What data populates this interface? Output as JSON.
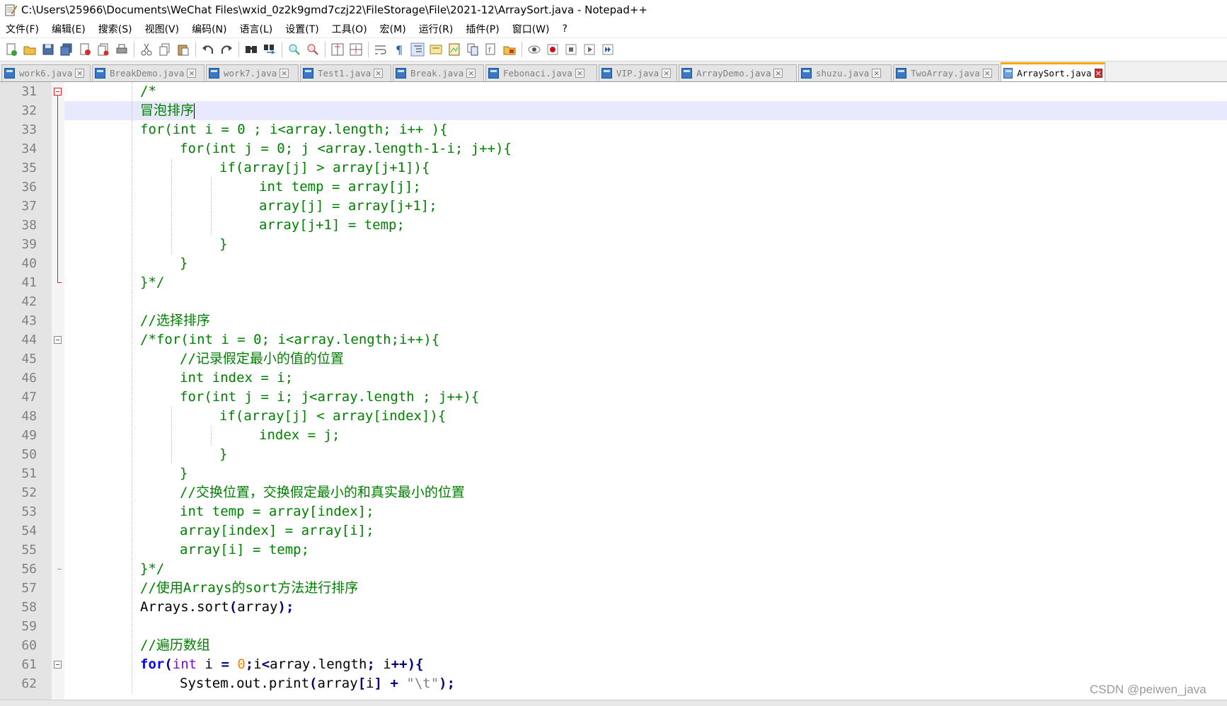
{
  "window": {
    "title": "C:\\Users\\25966\\Documents\\WeChat Files\\wxid_0z2k9gmd7czj22\\FileStorage\\File\\2021-12\\ArraySort.java - Notepad++",
    "icon": "notepad-icon"
  },
  "menu": [
    "文件(F)",
    "编辑(E)",
    "搜索(S)",
    "视图(V)",
    "编码(N)",
    "语言(L)",
    "设置(T)",
    "工具(O)",
    "宏(M)",
    "运行(R)",
    "插件(P)",
    "窗口(W)",
    "?"
  ],
  "toolbar": [
    "new-file-icon",
    "open-file-icon",
    "save-icon",
    "save-all-icon",
    "close-icon",
    "close-all-icon",
    "print-icon",
    "|",
    "cut-icon",
    "copy-icon",
    "paste-icon",
    "|",
    "undo-icon",
    "redo-icon",
    "|",
    "find-icon",
    "replace-icon",
    "|",
    "zoom-in-icon",
    "zoom-out-icon",
    "|",
    "sync-vertical-icon",
    "sync-horizontal-icon",
    "|",
    "word-wrap-icon",
    "show-all-chars-icon",
    "indent-guide-icon",
    "lang-define-icon",
    "doc-map-icon",
    "function-list-icon",
    "folder-workspace-icon",
    "monitor-icon",
    "|",
    "record-macro-icon",
    "stop-record-icon",
    "play-macro-icon",
    "run-macro-multiple-icon",
    "save-macro-icon"
  ],
  "tabs": [
    {
      "label": "work6.java",
      "active": false
    },
    {
      "label": "BreakDemo.java",
      "active": false
    },
    {
      "label": "work7.java",
      "active": false
    },
    {
      "label": "Test1.java",
      "active": false
    },
    {
      "label": "Break.java",
      "active": false
    },
    {
      "label": "Febonaci.java",
      "active": false
    },
    {
      "label": "VIP.java",
      "active": false
    },
    {
      "label": "ArrayDemo.java",
      "active": false
    },
    {
      "label": "shuzu.java",
      "active": false
    },
    {
      "label": "TwoArray.java",
      "active": false
    },
    {
      "label": "ArraySort.java",
      "active": true
    }
  ],
  "code_lines": [
    {
      "num": "31",
      "indent": 2,
      "text": "/*",
      "kind": "comment"
    },
    {
      "num": "32",
      "indent": 2,
      "text": "冒泡排序",
      "kind": "comment",
      "current": true
    },
    {
      "num": "33",
      "indent": 2,
      "text": "for(int i = 0 ; i<array.length; i++ ){",
      "kind": "comment"
    },
    {
      "num": "34",
      "indent": 3,
      "text": "for(int j = 0; j <array.length-1-i; j++){",
      "kind": "comment"
    },
    {
      "num": "35",
      "indent": 4,
      "text": "if(array[j] > array[j+1]){",
      "kind": "comment"
    },
    {
      "num": "36",
      "indent": 5,
      "text": "int temp = array[j];",
      "kind": "comment"
    },
    {
      "num": "37",
      "indent": 5,
      "text": "array[j] = array[j+1];",
      "kind": "comment"
    },
    {
      "num": "38",
      "indent": 5,
      "text": "array[j+1] = temp;",
      "kind": "comment"
    },
    {
      "num": "39",
      "indent": 4,
      "text": "}",
      "kind": "comment"
    },
    {
      "num": "40",
      "indent": 3,
      "text": "}",
      "kind": "comment"
    },
    {
      "num": "41",
      "indent": 2,
      "text": "}*/",
      "kind": "comment"
    },
    {
      "num": "42",
      "indent": 2,
      "text": "",
      "kind": "comment"
    },
    {
      "num": "43",
      "indent": 2,
      "text": "//选择排序",
      "kind": "comment"
    },
    {
      "num": "44",
      "indent": 2,
      "text": "/*for(int i = 0; i<array.length;i++){",
      "kind": "comment"
    },
    {
      "num": "45",
      "indent": 3,
      "text": "//记录假定最小的值的位置",
      "kind": "comment"
    },
    {
      "num": "46",
      "indent": 3,
      "text": "int index = i;",
      "kind": "comment"
    },
    {
      "num": "47",
      "indent": 3,
      "text": "for(int j = i; j<array.length ; j++){",
      "kind": "comment"
    },
    {
      "num": "48",
      "indent": 4,
      "text": "if(array[j] < array[index]){",
      "kind": "comment"
    },
    {
      "num": "49",
      "indent": 5,
      "text": "index = j;",
      "kind": "comment"
    },
    {
      "num": "50",
      "indent": 4,
      "text": "}",
      "kind": "comment"
    },
    {
      "num": "51",
      "indent": 3,
      "text": "}",
      "kind": "comment"
    },
    {
      "num": "52",
      "indent": 3,
      "text": "//交换位置，交换假定最小的和真实最小的位置",
      "kind": "comment"
    },
    {
      "num": "53",
      "indent": 3,
      "text": "int temp = array[index];",
      "kind": "comment"
    },
    {
      "num": "54",
      "indent": 3,
      "text": "array[index] = array[i];",
      "kind": "comment"
    },
    {
      "num": "55",
      "indent": 3,
      "text": "array[i] = temp;",
      "kind": "comment"
    },
    {
      "num": "56",
      "indent": 2,
      "text": "}*/",
      "kind": "comment"
    },
    {
      "num": "57",
      "indent": 2,
      "text": "//使用Arrays的sort方法进行排序",
      "kind": "comment"
    },
    {
      "num": "58",
      "indent": 2,
      "text": "Arrays.sort(array);",
      "kind": "code"
    },
    {
      "num": "59",
      "indent": 2,
      "text": "",
      "kind": "code"
    },
    {
      "num": "60",
      "indent": 2,
      "text": "//遍历数组",
      "kind": "comment"
    },
    {
      "num": "61",
      "indent": 2,
      "text": "for(int i = 0;i<array.length; i++){",
      "kind": "code"
    },
    {
      "num": "62",
      "indent": 3,
      "text": "System.out.print(array[i] + \"\\t\");",
      "kind": "code"
    }
  ],
  "colors": {
    "comment": "#008000",
    "keyword": "#0000ff",
    "type": "#8000ff",
    "number": "#ff8000",
    "string": "#808080",
    "operator": "#000080",
    "current_line": "#e8e8ff",
    "fold_marker": "#e02020",
    "active_tab_accent": "#f7a800"
  },
  "watermark": "CSDN @peiwen_java"
}
